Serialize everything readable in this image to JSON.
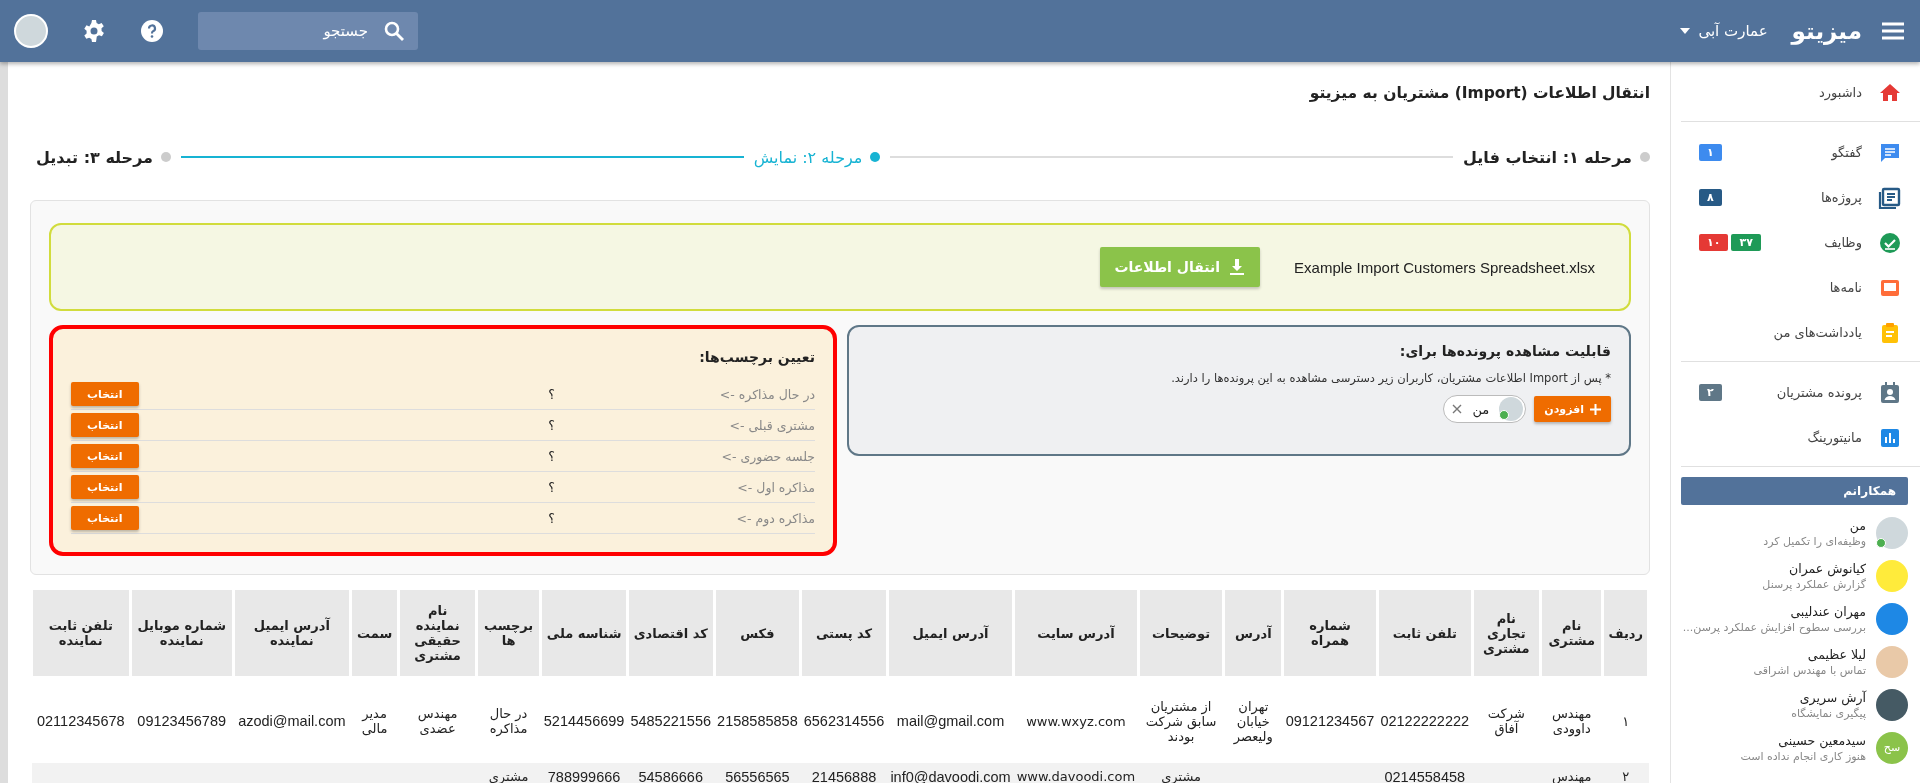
{
  "topbar": {
    "logo": "میزیتو",
    "org": "عمارت آبی",
    "search": {
      "placeholder": "جستجو"
    }
  },
  "sidebar": {
    "nav_groups": [
      {
        "items": [
          {
            "label": "داشبورد"
          }
        ]
      },
      {
        "items": [
          {
            "label": "گفتگو",
            "badges": [
              {
                "text": "۱",
                "color": "#3d8bef"
              }
            ]
          },
          {
            "label": "پروژه‌ها",
            "badges": [
              {
                "text": "۸",
                "color": "#275a86"
              }
            ]
          },
          {
            "label": "وظایف",
            "badges": [
              {
                "text": "۳۷",
                "color": "#1e9a57"
              },
              {
                "text": "۱۰",
                "color": "#e53935"
              }
            ]
          },
          {
            "label": "نامه‌ها"
          },
          {
            "label": "یادداشت‌های من"
          }
        ]
      },
      {
        "items": [
          {
            "label": "پرونده مشتریان",
            "badges": [
              {
                "text": "۲",
                "color": "#5f7787"
              }
            ]
          },
          {
            "label": "مانیتورینگ"
          }
        ]
      }
    ],
    "colleagues_title": "همکارانم",
    "colleagues": [
      {
        "name": "من",
        "status": "وظیفه‌ای را تکمیل کرد",
        "online": true
      },
      {
        "name": "کیانوش عمران",
        "status": "گزارش عملکرد پرسنل",
        "online": false
      },
      {
        "name": "مهران عندلیبی",
        "status": "بررسی سطوح افزایش عملکرد پرسن...",
        "online": false
      },
      {
        "name": "لیلا عظیمی",
        "status": "تماس با مهندس اشراقی",
        "online": false
      },
      {
        "name": "آرش سریری",
        "status": "پیگیری نمایشگاه",
        "online": false
      },
      {
        "name": "سیدمعین حسینی",
        "status": "هنوز کاری انجام نداده است",
        "online": false,
        "initials": "سح"
      }
    ]
  },
  "page_title": "انتقال اطلاعات (Import) مشتریان به میزیتو",
  "steps": [
    {
      "label": "مرحله ۱: انتخاب فایل",
      "selected": false
    },
    {
      "label": "مرحله ۲: نمایش",
      "selected": true
    },
    {
      "label": "مرحله ۳: تبدیل",
      "selected": false
    }
  ],
  "file": {
    "name": "Example Import Customers Spreadsheet.xlsx",
    "button": "انتقال اطلاعات"
  },
  "visibility": {
    "title": "قابلیت مشاهده پرونده‌ها برای:",
    "note": "* پس از Import اطلاعات مشتریان، کاربران زیر دسترسی مشاهده به این پرونده‌ها را دارند.",
    "add_button": "افزودن",
    "users": [
      {
        "name": "من",
        "online": true
      }
    ]
  },
  "tags": {
    "title": "تعیین برچسب‌ها:",
    "rows": [
      {
        "label": "در حال مذاکره ->",
        "value": "؟",
        "button": "انتخاب"
      },
      {
        "label": "مشتری قبلی ->",
        "value": "؟",
        "button": "انتخاب"
      },
      {
        "label": "جلسه حضوری ->",
        "value": "؟",
        "button": "انتخاب"
      },
      {
        "label": "مذاکره اول ->",
        "value": "؟",
        "button": "انتخاب"
      },
      {
        "label": "مذاکره دوم ->",
        "value": "؟",
        "button": "انتخاب"
      }
    ]
  },
  "table": {
    "columns": [
      "ردیف",
      "نام مشتری",
      "نام تجاری مشتری",
      "تلفن ثابت",
      "شماره همراه",
      "آدرس",
      "توضیحات",
      "آدرس سایت",
      "آدرس ایمیل",
      "کد پستی",
      "فکس",
      "کد اقتصادی",
      "شناسه ملی",
      "برچسب ها",
      "نام نماینده حقیقی مشتری",
      "سمت",
      "آدرس ایمیل نماینده",
      "شماره موبایل نماینده",
      "تلفن ثابت نماینده"
    ],
    "rows": [
      [
        "۱",
        "مهندس داوودی",
        "شرکت آفاق",
        "02122222222",
        "09121234567",
        "تهران خیابان ولیعصر",
        "از مشتریان سابق شرکت بودند",
        "www.wxyz.com",
        "mail@gmail.com",
        "6562314556",
        "2158585858",
        "5485221556",
        "5214456699",
        "در حال مذاکره",
        "مهندس عضدی",
        "مدیر مالی",
        "azodi@mail.com",
        "09123456789",
        "02112345678"
      ],
      [
        "۲",
        "مهندس",
        null,
        "0214558458",
        null,
        null,
        "مشتری",
        "www.davoodi.com",
        "inf0@davoodi.com",
        "21456888",
        "56556565",
        "54586666",
        "788999666",
        "مشتری",
        null,
        null,
        null,
        null,
        null
      ]
    ]
  }
}
